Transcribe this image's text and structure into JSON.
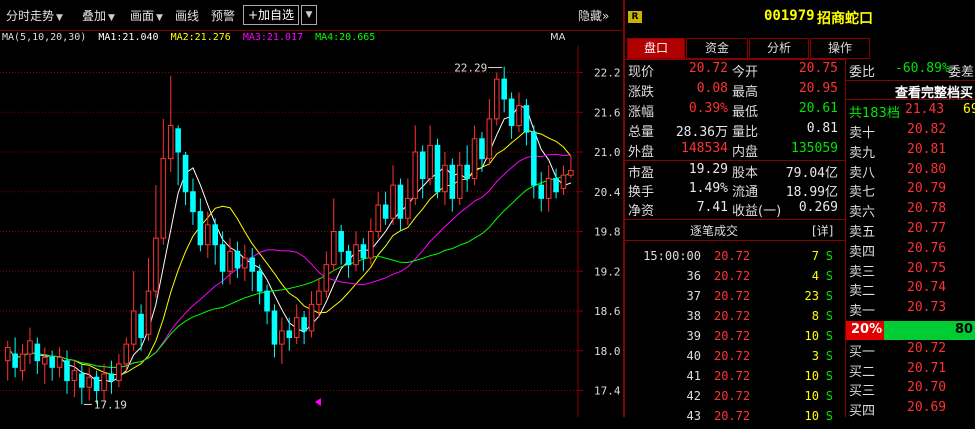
{
  "toolbar": {
    "items": [
      "分时走势",
      "叠加",
      "画面",
      "画线",
      "预警"
    ],
    "add_fav": "+加自选",
    "hide": "隐藏»"
  },
  "ma": {
    "label": "MA(5,10,20,30)",
    "ma1": "MA1:21.040",
    "ma2": "MA2:21.276",
    "ma3": "MA3:21.017",
    "ma4": "MA4:20.665",
    "right": "MA"
  },
  "colors": {
    "ma1": "#ffffff",
    "ma2": "#ffff00",
    "ma3": "#ff00ff",
    "ma4": "#00ff00",
    "up": "#ff3232",
    "up_body": "#000000",
    "down": "#00ffff"
  },
  "chart_data": {
    "type": "candlestick",
    "y_ticks": [
      "22.2",
      "21.6",
      "21.0",
      "20.4",
      "19.8",
      "19.2",
      "18.6",
      "18.0",
      "17.4"
    ],
    "ylim": [
      17.0,
      22.6
    ],
    "high_label": "22.29",
    "low_label": "17.19",
    "candles": [
      {
        "o": 17.85,
        "c": 18.05,
        "h": 18.15,
        "l": 17.55
      },
      {
        "o": 17.95,
        "c": 17.75,
        "h": 18.2,
        "l": 17.6
      },
      {
        "o": 17.7,
        "c": 17.95,
        "h": 18.1,
        "l": 17.55
      },
      {
        "o": 17.95,
        "c": 18.15,
        "h": 18.35,
        "l": 17.8
      },
      {
        "o": 18.1,
        "c": 17.85,
        "h": 18.2,
        "l": 17.65
      },
      {
        "o": 17.8,
        "c": 17.9,
        "h": 18.05,
        "l": 17.5
      },
      {
        "o": 17.9,
        "c": 17.75,
        "h": 18.0,
        "l": 17.55
      },
      {
        "o": 17.75,
        "c": 17.9,
        "h": 18.05,
        "l": 17.6
      },
      {
        "o": 17.85,
        "c": 17.55,
        "h": 18.0,
        "l": 17.35
      },
      {
        "o": 17.55,
        "c": 17.7,
        "h": 17.85,
        "l": 17.3
      },
      {
        "o": 17.65,
        "c": 17.45,
        "h": 17.8,
        "l": 17.19
      },
      {
        "o": 17.45,
        "c": 17.6,
        "h": 17.75,
        "l": 17.25
      },
      {
        "o": 17.6,
        "c": 17.4,
        "h": 17.7,
        "l": 17.2
      },
      {
        "o": 17.4,
        "c": 17.65,
        "h": 17.8,
        "l": 17.25
      },
      {
        "o": 17.65,
        "c": 17.55,
        "h": 17.85,
        "l": 17.35
      },
      {
        "o": 17.55,
        "c": 17.8,
        "h": 17.95,
        "l": 17.45
      },
      {
        "o": 17.8,
        "c": 18.1,
        "h": 18.2,
        "l": 17.7
      },
      {
        "o": 18.1,
        "c": 18.6,
        "h": 19.2,
        "l": 18.0
      },
      {
        "o": 18.55,
        "c": 18.2,
        "h": 18.7,
        "l": 18.0
      },
      {
        "o": 18.25,
        "c": 18.9,
        "h": 19.4,
        "l": 18.15
      },
      {
        "o": 18.9,
        "c": 19.7,
        "h": 20.5,
        "l": 18.8
      },
      {
        "o": 19.7,
        "c": 20.9,
        "h": 21.5,
        "l": 19.6
      },
      {
        "o": 20.9,
        "c": 21.4,
        "h": 22.15,
        "l": 20.7
      },
      {
        "o": 21.35,
        "c": 21.0,
        "h": 21.4,
        "l": 20.5
      },
      {
        "o": 20.95,
        "c": 20.4,
        "h": 21.0,
        "l": 20.2
      },
      {
        "o": 20.4,
        "c": 20.1,
        "h": 20.6,
        "l": 19.9
      },
      {
        "o": 20.1,
        "c": 19.6,
        "h": 20.3,
        "l": 19.5
      },
      {
        "o": 19.6,
        "c": 19.9,
        "h": 20.1,
        "l": 19.4
      },
      {
        "o": 19.9,
        "c": 19.6,
        "h": 20.0,
        "l": 19.3
      },
      {
        "o": 19.6,
        "c": 19.2,
        "h": 19.8,
        "l": 19.0
      },
      {
        "o": 19.2,
        "c": 19.5,
        "h": 19.7,
        "l": 19.0
      },
      {
        "o": 19.5,
        "c": 19.25,
        "h": 19.65,
        "l": 19.1
      },
      {
        "o": 19.25,
        "c": 19.4,
        "h": 19.6,
        "l": 19.05
      },
      {
        "o": 19.4,
        "c": 19.2,
        "h": 19.55,
        "l": 18.9
      },
      {
        "o": 19.2,
        "c": 18.9,
        "h": 19.3,
        "l": 18.7
      },
      {
        "o": 18.9,
        "c": 18.6,
        "h": 19.0,
        "l": 18.4
      },
      {
        "o": 18.6,
        "c": 18.1,
        "h": 18.7,
        "l": 17.9
      },
      {
        "o": 18.1,
        "c": 18.3,
        "h": 18.5,
        "l": 17.8
      },
      {
        "o": 18.3,
        "c": 18.2,
        "h": 18.5,
        "l": 18.0
      },
      {
        "o": 18.2,
        "c": 18.5,
        "h": 18.7,
        "l": 18.1
      },
      {
        "o": 18.5,
        "c": 18.3,
        "h": 18.6,
        "l": 18.1
      },
      {
        "o": 18.3,
        "c": 18.7,
        "h": 18.9,
        "l": 18.2
      },
      {
        "o": 18.7,
        "c": 18.9,
        "h": 19.1,
        "l": 18.5
      },
      {
        "o": 18.9,
        "c": 19.3,
        "h": 19.5,
        "l": 18.8
      },
      {
        "o": 19.3,
        "c": 19.8,
        "h": 20.3,
        "l": 19.2
      },
      {
        "o": 19.8,
        "c": 19.5,
        "h": 19.9,
        "l": 19.3
      },
      {
        "o": 19.5,
        "c": 19.3,
        "h": 19.6,
        "l": 19.1
      },
      {
        "o": 19.3,
        "c": 19.6,
        "h": 19.8,
        "l": 19.2
      },
      {
        "o": 19.6,
        "c": 19.4,
        "h": 19.7,
        "l": 19.2
      },
      {
        "o": 19.4,
        "c": 19.8,
        "h": 20.0,
        "l": 19.3
      },
      {
        "o": 19.8,
        "c": 20.2,
        "h": 20.4,
        "l": 19.7
      },
      {
        "o": 20.2,
        "c": 20.0,
        "h": 20.4,
        "l": 19.9
      },
      {
        "o": 20.0,
        "c": 20.5,
        "h": 20.8,
        "l": 19.9
      },
      {
        "o": 20.5,
        "c": 20.0,
        "h": 20.6,
        "l": 19.8
      },
      {
        "o": 20.0,
        "c": 20.3,
        "h": 20.6,
        "l": 19.9
      },
      {
        "o": 20.3,
        "c": 21.0,
        "h": 21.4,
        "l": 20.2
      },
      {
        "o": 21.0,
        "c": 20.6,
        "h": 21.1,
        "l": 20.3
      },
      {
        "o": 20.6,
        "c": 21.1,
        "h": 21.4,
        "l": 20.5
      },
      {
        "o": 21.1,
        "c": 20.4,
        "h": 21.2,
        "l": 20.3
      },
      {
        "o": 20.4,
        "c": 20.8,
        "h": 21.0,
        "l": 20.2
      },
      {
        "o": 20.8,
        "c": 20.3,
        "h": 20.9,
        "l": 20.1
      },
      {
        "o": 20.3,
        "c": 20.8,
        "h": 21.0,
        "l": 20.2
      },
      {
        "o": 20.8,
        "c": 20.6,
        "h": 21.1,
        "l": 20.4
      },
      {
        "o": 20.6,
        "c": 21.2,
        "h": 21.4,
        "l": 20.5
      },
      {
        "o": 21.2,
        "c": 20.9,
        "h": 21.3,
        "l": 20.7
      },
      {
        "o": 20.9,
        "c": 21.5,
        "h": 21.8,
        "l": 20.8
      },
      {
        "o": 21.5,
        "c": 22.1,
        "h": 22.2,
        "l": 21.4
      },
      {
        "o": 22.1,
        "c": 21.8,
        "h": 22.29,
        "l": 21.6
      },
      {
        "o": 21.8,
        "c": 21.4,
        "h": 21.9,
        "l": 21.2
      },
      {
        "o": 21.4,
        "c": 21.7,
        "h": 21.9,
        "l": 21.3
      },
      {
        "o": 21.7,
        "c": 21.3,
        "h": 21.8,
        "l": 21.1
      },
      {
        "o": 21.3,
        "c": 20.5,
        "h": 21.4,
        "l": 20.3
      },
      {
        "o": 20.5,
        "c": 20.3,
        "h": 20.7,
        "l": 20.1
      },
      {
        "o": 20.3,
        "c": 20.6,
        "h": 20.8,
        "l": 20.1
      },
      {
        "o": 20.6,
        "c": 20.4,
        "h": 20.75,
        "l": 20.3
      },
      {
        "o": 20.45,
        "c": 20.65,
        "h": 20.8,
        "l": 20.35
      },
      {
        "o": 20.65,
        "c": 20.72,
        "h": 20.95,
        "l": 20.61
      }
    ]
  },
  "stock": {
    "code": "001979",
    "name": "招商蛇口",
    "badge": "R"
  },
  "tabs": [
    "盘口",
    "资金",
    "分析",
    "操作"
  ],
  "quote": [
    {
      "l1": "现价",
      "v1": "20.72",
      "c1": "red",
      "l2": "今开",
      "v2": "20.75",
      "c2": "red"
    },
    {
      "l1": "涨跌",
      "v1": "0.08",
      "c1": "red",
      "l2": "最高",
      "v2": "20.95",
      "c2": "red"
    },
    {
      "l1": "涨幅",
      "v1": "0.39%",
      "c1": "red",
      "l2": "最低",
      "v2": "20.61",
      "c2": "green"
    },
    {
      "l1": "总量",
      "v1": "28.36万",
      "c1": "white",
      "l2": "量比",
      "v2": "0.81",
      "c2": "white"
    },
    {
      "l1": "外盘",
      "v1": "148534",
      "c1": "red",
      "l2": "内盘",
      "v2": "135059",
      "c2": "green"
    }
  ],
  "fundamentals": [
    {
      "l1": "市盈",
      "v1": "19.29",
      "l2": "股本",
      "v2": "79.04亿"
    },
    {
      "l1": "换手",
      "v1": "1.49%",
      "l2": "流通",
      "v2": "18.99亿"
    },
    {
      "l1": "净资",
      "v1": "7.41",
      "l2": "收益(一)",
      "v2": "0.269"
    }
  ],
  "ticks": {
    "title": "逐笔成交",
    "detail": "[详]",
    "rows": [
      {
        "t": "15:00:00",
        "p": "20.72",
        "v": "7",
        "s": "S"
      },
      {
        "t": "36",
        "p": "20.72",
        "v": "4",
        "s": "S"
      },
      {
        "t": "37",
        "p": "20.72",
        "v": "23",
        "s": "S"
      },
      {
        "t": "38",
        "p": "20.72",
        "v": "8",
        "s": "S"
      },
      {
        "t": "39",
        "p": "20.72",
        "v": "10",
        "s": "S"
      },
      {
        "t": "40",
        "p": "20.72",
        "v": "3",
        "s": "S"
      },
      {
        "t": "41",
        "p": "20.72",
        "v": "10",
        "s": "S"
      },
      {
        "t": "42",
        "p": "20.72",
        "v": "10",
        "s": "S"
      },
      {
        "t": "43",
        "p": "20.72",
        "v": "10",
        "s": "S"
      }
    ]
  },
  "orderbook": {
    "weibi_label": "委比",
    "weibi": "-60.89%",
    "weicha": "委差",
    "full_link": "查看完整档买",
    "total_label": "共183档",
    "total_price": "21.43",
    "total_vol": "69",
    "asks": [
      {
        "l": "卖十",
        "p": "20.82"
      },
      {
        "l": "卖九",
        "p": "20.81"
      },
      {
        "l": "卖八",
        "p": "20.80"
      },
      {
        "l": "卖七",
        "p": "20.79"
      },
      {
        "l": "卖六",
        "p": "20.78"
      },
      {
        "l": "卖五",
        "p": "20.77"
      },
      {
        "l": "卖四",
        "p": "20.76"
      },
      {
        "l": "卖三",
        "p": "20.75"
      },
      {
        "l": "卖二",
        "p": "20.74"
      },
      {
        "l": "卖一",
        "p": "20.73"
      }
    ],
    "ratio_left": "20%",
    "ratio_right": "80",
    "bids": [
      {
        "l": "买一",
        "p": "20.72"
      },
      {
        "l": "买二",
        "p": "20.71"
      },
      {
        "l": "买三",
        "p": "20.70"
      },
      {
        "l": "买四",
        "p": "20.69"
      }
    ]
  }
}
